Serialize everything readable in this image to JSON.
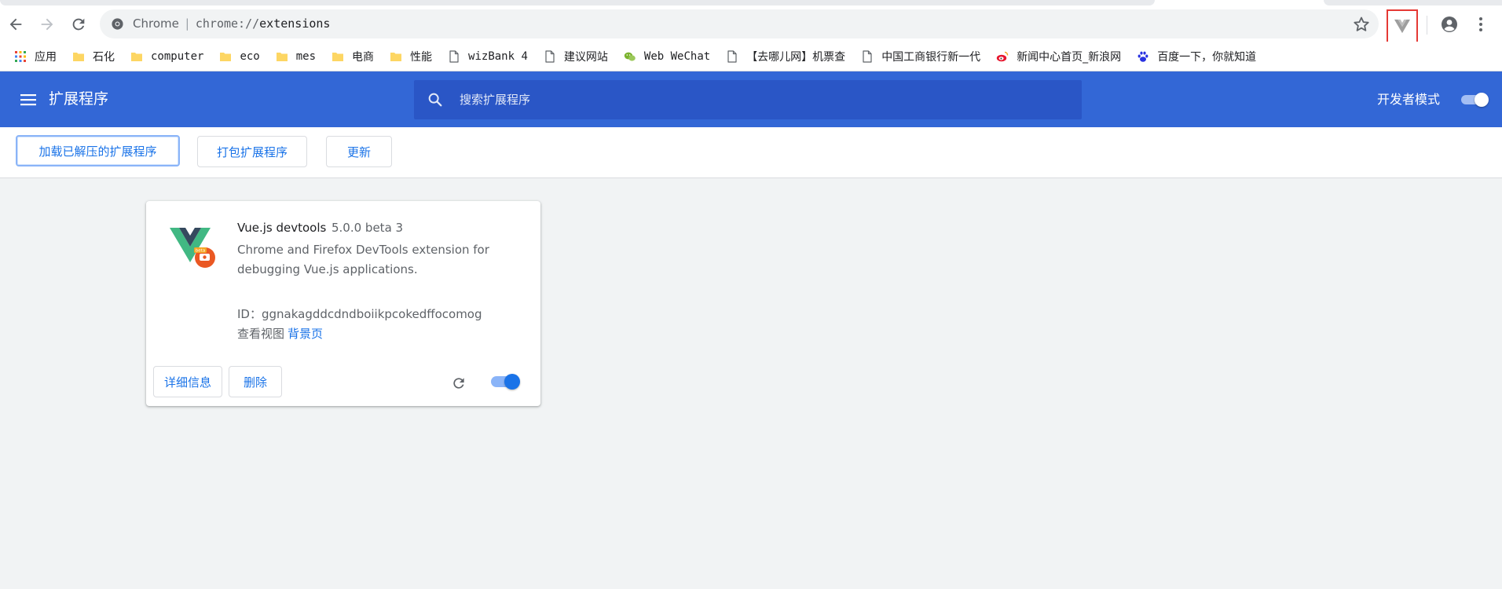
{
  "browser": {
    "omnibox": {
      "site_label": "Chrome",
      "separator": "|",
      "url_scheme": "chrome://",
      "url_host": "extensions"
    },
    "icons": {
      "back": "back-arrow-icon",
      "forward": "forward-arrow-icon",
      "reload": "reload-icon",
      "bookmark_star": "star-icon",
      "extension": "vue-devtools-icon",
      "profile": "account-circle-icon",
      "menu": "more-vert-icon"
    },
    "bookmarks": [
      {
        "label": "应用",
        "icon": "apps-grid-icon"
      },
      {
        "label": "石化",
        "icon": "folder-icon"
      },
      {
        "label": "computer",
        "icon": "folder-icon"
      },
      {
        "label": "eco",
        "icon": "folder-icon"
      },
      {
        "label": "mes",
        "icon": "folder-icon"
      },
      {
        "label": "电商",
        "icon": "folder-icon"
      },
      {
        "label": "性能",
        "icon": "folder-icon"
      },
      {
        "label": "wizBank 4",
        "icon": "page-icon"
      },
      {
        "label": "建议网站",
        "icon": "page-icon"
      },
      {
        "label": "Web WeChat",
        "icon": "wechat-icon"
      },
      {
        "label": "【去哪儿网】机票查",
        "icon": "page-icon"
      },
      {
        "label": "中国工商银行新一代",
        "icon": "page-icon"
      },
      {
        "label": "新闻中心首页_新浪网",
        "icon": "weibo-icon"
      },
      {
        "label": "百度一下，你就知道",
        "icon": "baidu-paw-icon"
      }
    ]
  },
  "extensions_page": {
    "title": "扩展程序",
    "search": {
      "placeholder": "搜索扩展程序"
    },
    "developer_mode": {
      "label": "开发者模式",
      "enabled": true
    },
    "toolbar": {
      "load_unpacked": "加载已解压的扩展程序",
      "pack": "打包扩展程序",
      "update": "更新"
    },
    "colors": {
      "header_bg": "#3367d6",
      "search_bg": "#2a56c6",
      "link_blue": "#1a73e8",
      "page_bg": "#f1f3f4",
      "highlight_red": "#e53935"
    }
  },
  "extension_card": {
    "name": "Vue.js devtools",
    "version": "5.0.0 beta 3",
    "description": "Chrome and Firefox DevTools extension for debugging Vue.js applications.",
    "id_text": "ID：ggnakagddcdndboiikpcokedffocomog",
    "inspect_views_label": "查看视图",
    "inspect_views_link": "背景页",
    "details_button": "详细信息",
    "remove_button": "删除",
    "enabled": true,
    "logo_badge_text": "beta"
  }
}
